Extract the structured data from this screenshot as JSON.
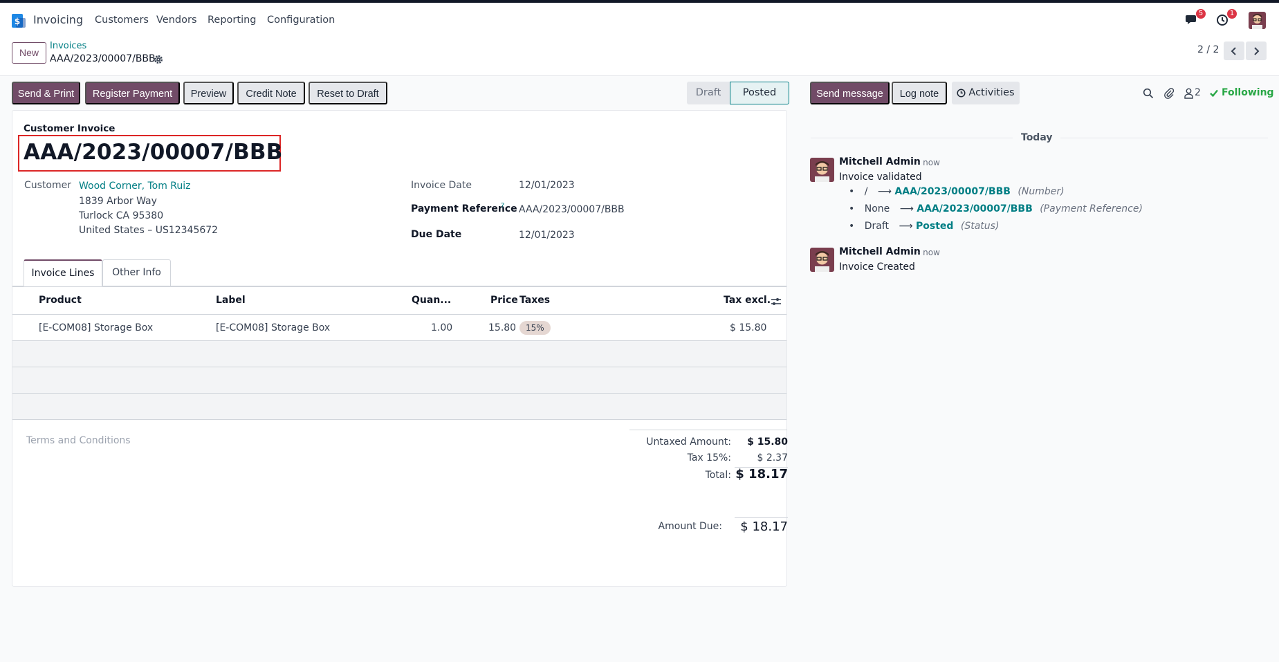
{
  "navbar": {
    "app_name": "Invoicing",
    "menu": [
      "Customers",
      "Vendors",
      "Reporting",
      "Configuration"
    ],
    "messages_badge": "5",
    "activities_badge": "1"
  },
  "control_panel": {
    "new_label": "New",
    "breadcrumb_parent": "Invoices",
    "breadcrumb_current": "AAA/2023/00007/BBB",
    "pager_value": "2 / 2"
  },
  "actions": {
    "send_print": "Send & Print",
    "register_payment": "Register Payment",
    "preview": "Preview",
    "credit_note": "Credit Note",
    "reset_to_draft": "Reset to Draft"
  },
  "statusbar": {
    "draft": "Draft",
    "posted": "Posted"
  },
  "invoice": {
    "type_label": "Customer Invoice",
    "number": "AAA/2023/00007/BBB",
    "customer_label": "Customer",
    "customer_name": "Wood Corner, Tom Ruiz",
    "address_line1": "1839 Arbor Way",
    "address_line2": "Turlock CA 95380",
    "address_line3": "United States – US12345672",
    "invoice_date_label": "Invoice Date",
    "invoice_date": "12/01/2023",
    "payment_ref_label": "Payment Reference",
    "payment_ref_help": "?",
    "payment_ref": "AAA/2023/00007/BBB",
    "due_date_label": "Due Date",
    "due_date": "12/01/2023"
  },
  "tabs": {
    "invoice_lines": "Invoice Lines",
    "other_info": "Other Info"
  },
  "lines": {
    "headers": {
      "product": "Product",
      "label": "Label",
      "quantity": "Quan...",
      "price": "Price",
      "taxes": "Taxes",
      "tax_excl": "Tax excl."
    },
    "rows": [
      {
        "product": "[E-COM08] Storage Box",
        "label": "[E-COM08] Storage Box",
        "quantity": "1.00",
        "price": "15.80",
        "tax": "15%",
        "subtotal": "$ 15.80"
      }
    ]
  },
  "terms_placeholder": "Terms and Conditions",
  "totals": {
    "untaxed_label": "Untaxed Amount:",
    "untaxed_value": "$ 15.80",
    "tax_label": "Tax 15%:",
    "tax_value": "$ 2.37",
    "total_label": "Total:",
    "total_value": "$ 18.17",
    "amount_due_label": "Amount Due:",
    "amount_due_value": "$ 18.17"
  },
  "chatter": {
    "send_message": "Send message",
    "log_note": "Log note",
    "activities": "Activities",
    "followers_count": "2",
    "following": "Following",
    "today": "Today",
    "messages": [
      {
        "author": "Mitchell Admin",
        "time": "- now",
        "body": "Invoice validated",
        "changes": [
          {
            "old": "/",
            "new": "AAA/2023/00007/BBB",
            "field": "(Number)"
          },
          {
            "old": "None",
            "new": "AAA/2023/00007/BBB",
            "field": "(Payment Reference)"
          },
          {
            "old": "Draft",
            "new": "Posted",
            "field": "(Status)"
          }
        ]
      },
      {
        "author": "Mitchell Admin",
        "time": "- now",
        "body": "Invoice Created"
      }
    ]
  },
  "colors": {
    "primary": "#714b67",
    "link": "#017e84",
    "following": "#28a745",
    "badge": "#dc3545",
    "highlight": "#dc2626"
  }
}
